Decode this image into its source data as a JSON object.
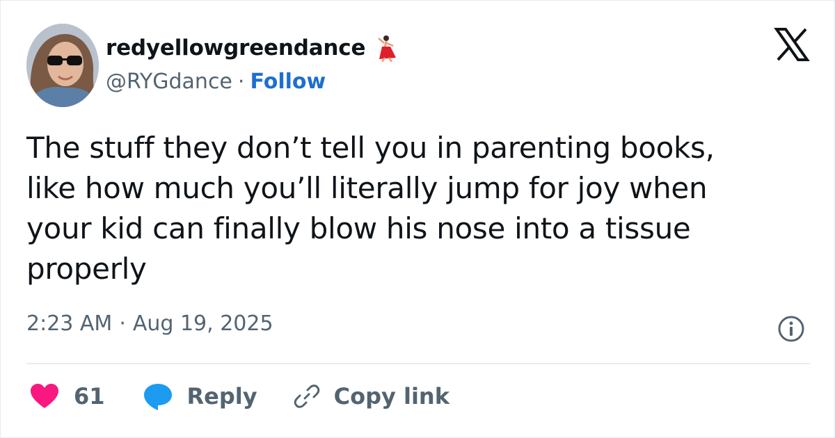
{
  "author": {
    "display_name": "redyellowgreendance",
    "handle": "@RYGdance",
    "separator": "·",
    "follow_label": "Follow",
    "name_emoji": "dancer-icon",
    "avatar": "avatar-photo"
  },
  "brand": {
    "logo": "x-logo-icon"
  },
  "tweet": {
    "text": "The stuff they don’t tell you in parenting books,\nlike how much you’ll literally jump for joy when\nyour kid can finally blow his nose into a tissue\nproperly",
    "time": "2:23 AM",
    "separator": "·",
    "date": "Aug 19, 2025"
  },
  "actions": {
    "like_count": "61",
    "reply_label": "Reply",
    "copy_link_label": "Copy link"
  },
  "colors": {
    "text": "#0f1419",
    "secondary": "#536471",
    "link": "#1d6fcf",
    "heart": "#f91880",
    "reply_bubble": "#1d9bf0",
    "divider": "#e6ecf0"
  }
}
